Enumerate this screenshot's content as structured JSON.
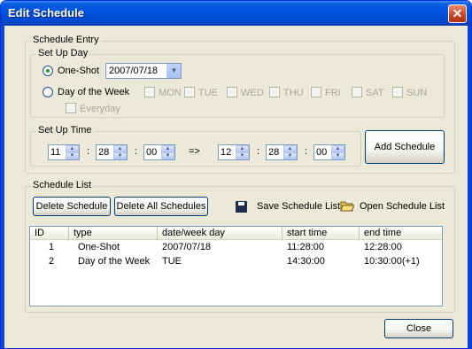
{
  "window": {
    "title": "Edit Schedule",
    "close_glyph": "✕"
  },
  "schedule_entry": {
    "legend": "Schedule Entry",
    "set_up_day": {
      "legend": "Set Up Day",
      "one_shot_label": "One-Shot",
      "date_value": "2007/07/18",
      "day_of_week_label": "Day of the Week",
      "days": [
        "MON",
        "TUE",
        "WED",
        "THU",
        "FRI",
        "SAT",
        "SUN"
      ],
      "everyday_label": "Everyday"
    },
    "set_up_time": {
      "legend": "Set Up Time",
      "start": {
        "hour": "11",
        "minute": "28",
        "second": "00"
      },
      "end": {
        "hour": "12",
        "minute": "28",
        "second": "00"
      },
      "separator": ":",
      "arrow": "=>"
    },
    "add_button": "Add Schedule"
  },
  "schedule_list": {
    "legend": "Schedule List",
    "delete_button": "Delete Schedule",
    "delete_all_button": "Delete All Schedules",
    "save_label": "Save Schedule List",
    "open_label": "Open Schedule List",
    "columns": [
      "ID",
      "type",
      "date/week day",
      "start time",
      "end time"
    ],
    "rows": [
      {
        "id": "1",
        "type": "One-Shot",
        "date": "2007/07/18",
        "start": "11:28:00",
        "end": "12:28:00"
      },
      {
        "id": "2",
        "type": "Day of the Week",
        "date": "TUE",
        "start": "14:30:00",
        "end": "10:30:00(+1)"
      }
    ]
  },
  "close_button": "Close"
}
